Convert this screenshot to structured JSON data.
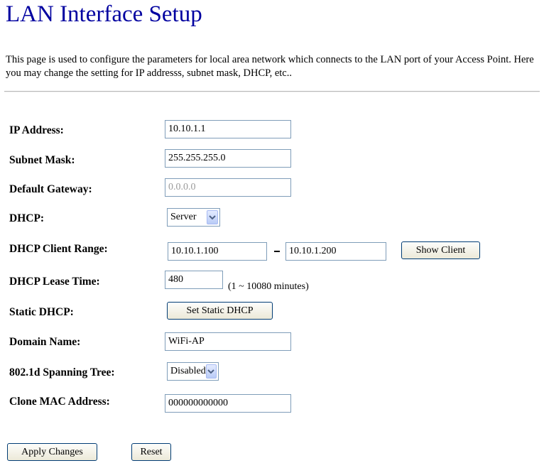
{
  "page": {
    "title": "LAN Interface Setup",
    "description": "This page is used to configure the parameters for local area network which connects to the LAN port of your Access Point. Here you may change the setting for IP addresss, subnet mask, DHCP, etc.."
  },
  "form": {
    "ip_address": {
      "label": "IP Address:",
      "value": "10.10.1.1"
    },
    "subnet_mask": {
      "label": "Subnet Mask:",
      "value": "255.255.255.0"
    },
    "default_gateway": {
      "label": "Default Gateway:",
      "value": "0.0.0.0"
    },
    "dhcp": {
      "label": "DHCP:",
      "selected": "Server"
    },
    "dhcp_client_range": {
      "label": "DHCP Client Range:",
      "start": "10.10.1.100",
      "end": "10.10.1.200",
      "show_client_label": "Show Client"
    },
    "dhcp_lease_time": {
      "label": "DHCP Lease Time:",
      "value": "480",
      "hint": "(1 ~ 10080 minutes)"
    },
    "static_dhcp": {
      "label": "Static DHCP:",
      "button_label": "Set Static DHCP"
    },
    "domain_name": {
      "label": "Domain Name:",
      "value": "WiFi-AP"
    },
    "spanning_tree": {
      "label": "802.1d Spanning Tree:",
      "selected": "Disabled"
    },
    "clone_mac": {
      "label": "Clone MAC Address:",
      "value": "000000000000"
    }
  },
  "actions": {
    "apply_label": "Apply Changes",
    "reset_label": "Reset"
  },
  "colors": {
    "title": "#0000a0",
    "input_border": "#7f9db9",
    "button_border": "#003c74"
  },
  "icons": {
    "dropdown": "chevron-down-icon"
  }
}
